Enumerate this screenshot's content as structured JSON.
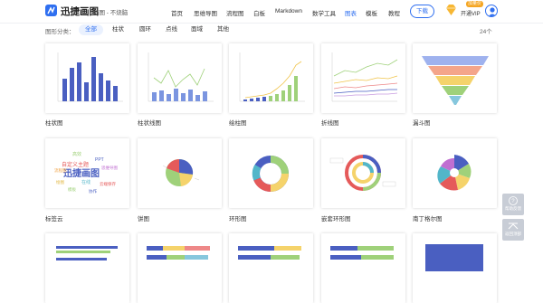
{
  "header": {
    "brand": "迅捷画图",
    "slogan": "脑图 - 不烧脑",
    "nav": [
      {
        "label": "首页",
        "active": false
      },
      {
        "label": "思维导图",
        "active": false
      },
      {
        "label": "流程图",
        "active": false
      },
      {
        "label": "白板",
        "active": false
      },
      {
        "label": "Markdown",
        "active": false
      },
      {
        "label": "数学工具",
        "active": false
      },
      {
        "label": "图表",
        "active": true
      },
      {
        "label": "模板",
        "active": false
      },
      {
        "label": "教程",
        "active": false
      }
    ],
    "download_label": "下载",
    "vip_badge": "加量价",
    "vip_label": "开通VIP",
    "accent_color": "#2f6ff0"
  },
  "filter": {
    "label": "图形分类：",
    "options": [
      {
        "label": "全部",
        "active": true
      },
      {
        "label": "柱状",
        "active": false
      },
      {
        "label": "圆环",
        "active": false
      },
      {
        "label": "点线",
        "active": false
      },
      {
        "label": "面域",
        "active": false
      },
      {
        "label": "其他",
        "active": false
      }
    ],
    "count": "24个"
  },
  "cards": [
    {
      "title": "柱状图",
      "icon": "bar-chart-thumbnail"
    },
    {
      "title": "柱状线图",
      "icon": "bar-line-chart-thumbnail"
    },
    {
      "title": "绘柱图",
      "icon": "bar-with-line-thumbnail"
    },
    {
      "title": "折线图",
      "icon": "line-chart-thumbnail"
    },
    {
      "title": "漏斗图",
      "icon": "funnel-chart-thumbnail"
    },
    {
      "title": "标签云",
      "icon": "word-cloud-thumbnail"
    },
    {
      "title": "饼图",
      "icon": "pie-chart-thumbnail"
    },
    {
      "title": "环形图",
      "icon": "donut-chart-thumbnail"
    },
    {
      "title": "嵌套环形图",
      "icon": "nested-donut-thumbnail"
    },
    {
      "title": "南丁格尔图",
      "icon": "rose-chart-thumbnail"
    },
    {
      "title": "",
      "icon": "horizontal-bar-thumbnail"
    },
    {
      "title": "",
      "icon": "stacked-bar-thumbnail"
    },
    {
      "title": "",
      "icon": "stacked-bar-thumbnail"
    },
    {
      "title": "",
      "icon": "stacked-bar-thumbnail"
    },
    {
      "title": "",
      "icon": "block-bar-thumbnail"
    }
  ],
  "wordcloud": {
    "words": [
      "迅捷画图",
      "自定义主题",
      "PPT",
      "流程图",
      "高效",
      "思维导图",
      "绘图",
      "在线",
      "云端保存",
      "模板",
      "协作"
    ]
  },
  "side": {
    "help": "帮助反馈",
    "top": "返回顶部"
  }
}
